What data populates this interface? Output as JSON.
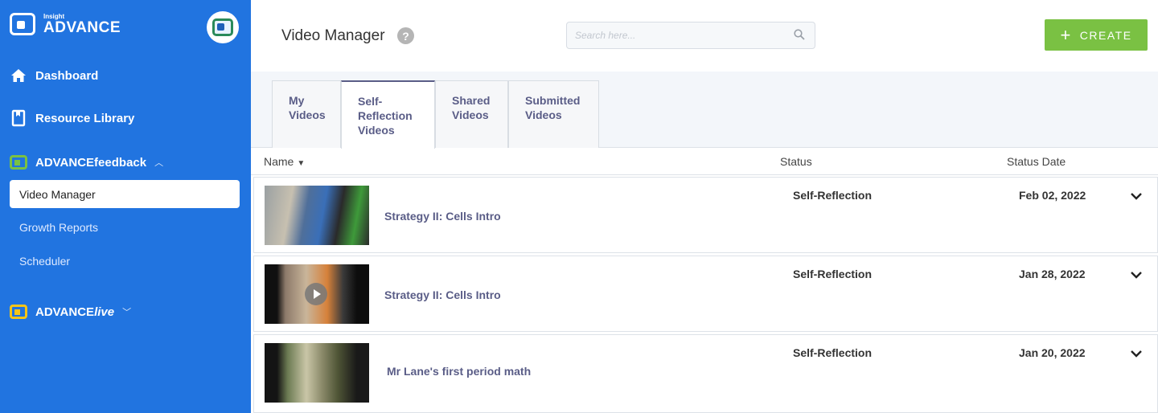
{
  "brand": {
    "small": "Insight",
    "big": "ADVANCE"
  },
  "sidebar": {
    "dashboard": "Dashboard",
    "resource_library": "Resource Library",
    "advance_feedback": "ADVANCEfeedback",
    "sub_items": [
      "Video Manager",
      "Growth Reports",
      "Scheduler"
    ],
    "advance_live_prefix": "ADVANCE",
    "advance_live_suffix": "live"
  },
  "header": {
    "title": "Video Manager",
    "help": "?",
    "search_placeholder": "Search here...",
    "create_label": "CREATE",
    "create_plus": "+"
  },
  "tabs": [
    {
      "label_lines": [
        "My",
        "Videos"
      ],
      "active": false
    },
    {
      "label_lines": [
        "Self-",
        "Reflection",
        "Videos"
      ],
      "active": true
    },
    {
      "label_lines": [
        "Shared",
        "Videos"
      ],
      "active": false
    },
    {
      "label_lines": [
        "Submitted",
        "Videos"
      ],
      "active": false
    }
  ],
  "table": {
    "columns": {
      "name": "Name",
      "status": "Status",
      "status_date": "Status Date"
    },
    "rows": [
      {
        "title": "Strategy II: Cells Intro",
        "status": "Self-Reflection",
        "date": "Feb 02, 2022"
      },
      {
        "title": "Strategy II: Cells Intro",
        "status": "Self-Reflection",
        "date": "Jan 28, 2022"
      },
      {
        "title": "Mr Lane's first period math",
        "status": "Self-Reflection",
        "date": "Jan 20, 2022"
      }
    ]
  },
  "colors": {
    "sidebar_bg": "#2174e0",
    "accent_green": "#7ac143",
    "accent_yellow": "#f5c518",
    "link_purple": "#5a5d87"
  }
}
